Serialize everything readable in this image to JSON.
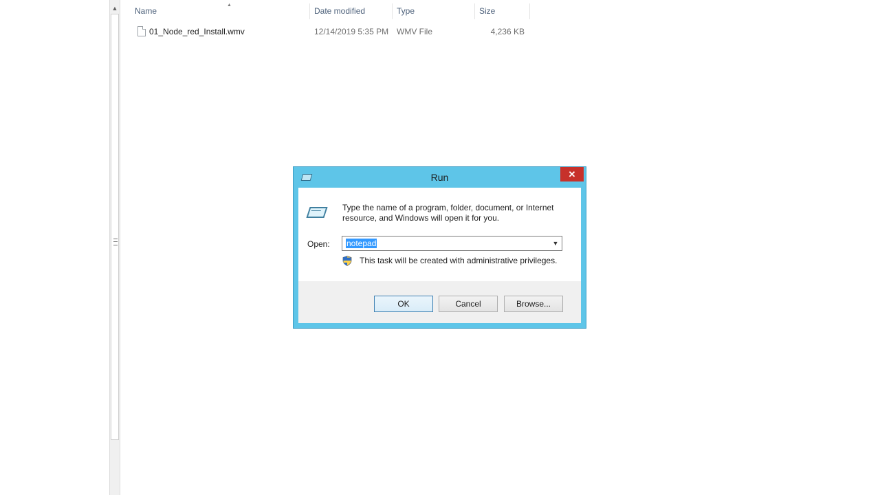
{
  "explorer": {
    "columns": {
      "name": "Name",
      "date_modified": "Date modified",
      "type": "Type",
      "size": "Size"
    },
    "files": [
      {
        "name": "01_Node_red_Install.wmv",
        "date_modified": "12/14/2019 5:35 PM",
        "type": "WMV File",
        "size": "4,236 KB"
      }
    ]
  },
  "run_dialog": {
    "title": "Run",
    "close_glyph": "✕",
    "description": "Type the name of a program, folder, document, or Internet resource, and Windows will open it for you.",
    "open_label": "Open:",
    "open_value": "notepad",
    "admin_note": "This task will be created with administrative privileges.",
    "buttons": {
      "ok": "OK",
      "cancel": "Cancel",
      "browse": "Browse..."
    }
  },
  "colors": {
    "dialog_frame": "#5ec5e8",
    "close_button": "#c7312b",
    "selection": "#3399ff"
  }
}
